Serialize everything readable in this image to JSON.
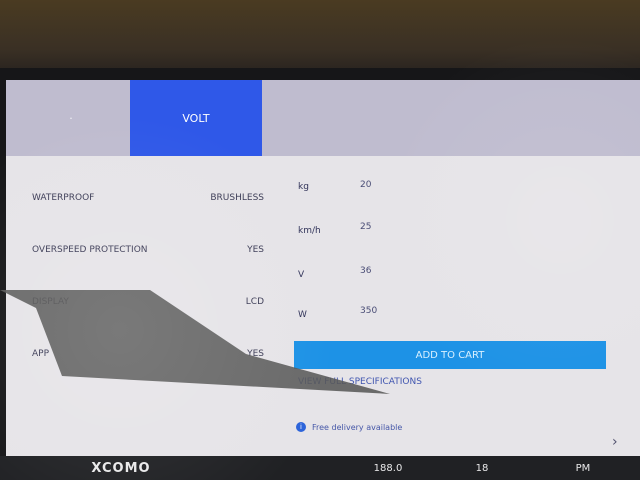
{
  "header": {
    "tabs": [
      {
        "label": "·"
      },
      {
        "label": "VOLT"
      },
      {
        "label": ""
      },
      {
        "label": ""
      }
    ]
  },
  "left_panel": {
    "rows": [
      {
        "label": "WATERPROOF",
        "value": "BRUSHLESS"
      },
      {
        "label": "OVERSPEED PROTECTION",
        "value": "YES"
      },
      {
        "label": "DISPLAY",
        "value": "LCD"
      },
      {
        "label": "APP",
        "value": "YES"
      }
    ]
  },
  "right_panel": {
    "specs": [
      {
        "label": "kg",
        "value": "20"
      },
      {
        "label": "km/h",
        "value": "25"
      },
      {
        "label": "V",
        "value": "36"
      },
      {
        "label": "W",
        "value": "350"
      }
    ],
    "cta_button": "ADD TO CART",
    "link": "VIEW FULL SPECIFICATIONS",
    "status": "Free delivery available"
  },
  "footer": {
    "brand": "XCOMO",
    "value1": "188.0",
    "value2": "18",
    "value3": "PM"
  }
}
